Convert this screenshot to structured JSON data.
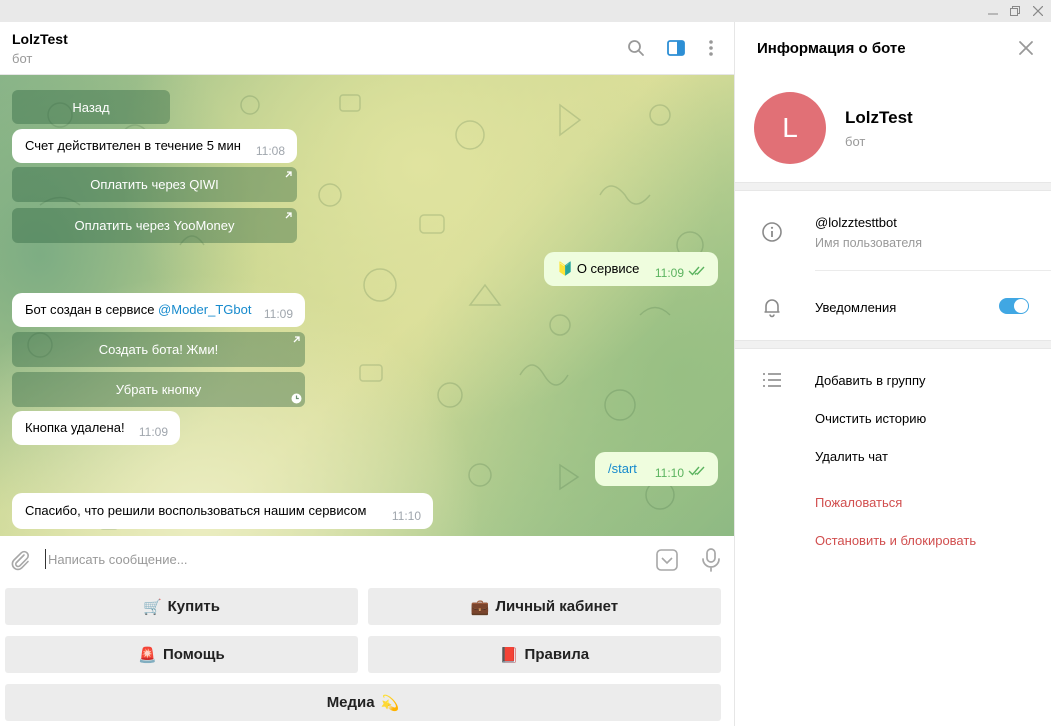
{
  "window": {
    "minimize": "—",
    "restore": "❐",
    "close": "✕"
  },
  "chat": {
    "title": "LolzTest",
    "subtitle": "бот"
  },
  "messages": {
    "back_button": "Назад",
    "invoice_text": "Счет действителен в течение 5 мин",
    "invoice_time": "11:08",
    "pay_qiwi": "Оплатить через QIWI",
    "pay_yoomoney": "Оплатить через YooMoney",
    "about_out_text": "О сервисе",
    "about_out_emoji": "🔰",
    "about_out_time": "11:09",
    "created_text": "Бот создан в сервисе ",
    "created_link": "@Moder_TGbot",
    "created_time": "11:09",
    "create_bot_button": "Создать бота! Жми!",
    "remove_button": "Убрать кнопку",
    "removed_text": "Кнопка удалена!",
    "removed_time": "11:09",
    "start_out_text": "/start",
    "start_out_time": "11:10",
    "thanks_text": "Спасибо, что решили воспользоваться нашим сервисом",
    "thanks_time": "11:10"
  },
  "input": {
    "placeholder": "Написать сообщение..."
  },
  "keyboard": {
    "buy": {
      "emoji": "🛒",
      "label": "Купить"
    },
    "cabinet": {
      "emoji": "💼",
      "label": "Личный кабинет"
    },
    "help": {
      "emoji": "🚨",
      "label": "Помощь"
    },
    "rules": {
      "emoji": "📕",
      "label": "Правила"
    },
    "media": {
      "emoji": "💫",
      "label": "Медиа"
    }
  },
  "side": {
    "title": "Информация о боте",
    "avatar_letter": "L",
    "avatar_color": "#e17076",
    "name": "LolzTest",
    "sub": "бот",
    "username": "@lolzztesttbot",
    "username_label": "Имя пользователя",
    "notifications_label": "Уведомления",
    "notifications_on": true,
    "add_to_group": "Добавить в группу",
    "clear_history": "Очистить историю",
    "delete_chat": "Удалить чат",
    "report": "Пожаловаться",
    "stop_block": "Остановить и блокировать"
  },
  "colors": {
    "accent": "#40a7e3",
    "danger": "#d14e4e",
    "outgoing_bubble": "#effdde",
    "read_checks": "#5bb35f"
  }
}
